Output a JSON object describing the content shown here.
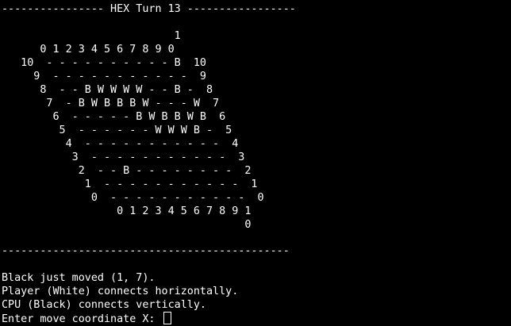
{
  "colors": {
    "background": "#000000",
    "foreground": "#ffffff"
  },
  "header": {
    "text": "---------------- HEX Turn 13 -----------------"
  },
  "board": {
    "lines": [
      "                           1",
      "      0 1 2 3 4 5 6 7 8 9 0",
      "   10  - - - - - - - - - - B  10",
      "     9  - - - - - - - - - - -  9",
      "      8  - - B W W W W - - B -  8",
      "       7  - B W B B B W - - - W  7",
      "        6  - - - - - B W B B W B  6",
      "         5  - - - - - - W W W B -  5",
      "          4  - - - - - - - - - - -  4",
      "           3  - - - - - - - - - - -  3",
      "            2  - - B - - - - - - - -  2",
      "             1  - - - - - - - - - - -  1",
      "              0  - - - - - - - - - - -  0",
      "                  0 1 2 3 4 5 6 7 8 9 1",
      "                                      0"
    ]
  },
  "divider": {
    "text": "---------------------------------------------"
  },
  "messages": {
    "last_move": "Black just moved (1, 7).",
    "player_info": "Player (White) connects horizontally.",
    "cpu_info": "CPU (Black) connects vertically.",
    "prompt": "Enter move coordinate X: "
  },
  "input": {
    "value": ""
  }
}
